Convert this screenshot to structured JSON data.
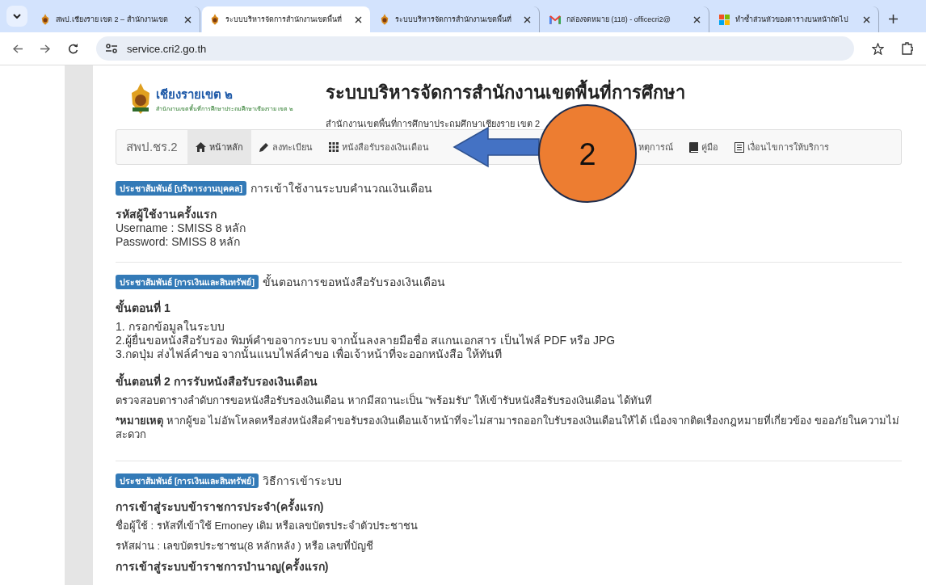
{
  "browser": {
    "tabs": [
      {
        "title": "สพป.เชียงราย เขต 2 – สำนักงานเขต",
        "selected": false
      },
      {
        "title": "ระบบบริหารจัดการสำนักงานเขตพื้นที่",
        "selected": true
      },
      {
        "title": "ระบบบริหารจัดการสำนักงานเขตพื้นที่",
        "selected": false
      },
      {
        "title": "กล่องจดหมาย (118) - officecri2@",
        "selected": false
      },
      {
        "title": "ทำซ้ำส่วนหัวของตารางบนหน้าถัดไป",
        "selected": false
      }
    ],
    "address": "service.cri2.go.th"
  },
  "header": {
    "logo_text": "เชียงรายเขต ๒",
    "logo_subtext": "สำนักงานเขตพื้นที่การศึกษาประถมศึกษาเชียงราย เขต ๒",
    "title": "ระบบบริหารจัดการสำนักงานเขตพื้นที่การศึกษา",
    "subtitle": "สำนักงานเขตพื้นที่การศึกษาประถมศึกษาเชียงราย เขต 2"
  },
  "nav": {
    "brand": "สพป.ชร.2",
    "items": [
      {
        "label": "หน้าหลัก",
        "selected": true
      },
      {
        "label": "ลงทะเบียน",
        "selected": false
      },
      {
        "label": "หนังสือรับรองเงินเดือน",
        "selected": false
      },
      {
        "label": "หตุการณ์",
        "selected": false
      },
      {
        "label": "คู่มือ",
        "selected": false
      },
      {
        "label": "เงื่อนไขการให้บริการ",
        "selected": false
      }
    ]
  },
  "callout": {
    "number": "2"
  },
  "sections": [
    {
      "badge": "ประชาสัมพันธ์ [บริหารงานบุคคล]",
      "title": "การเข้าใช้งานระบบคำนวณเงินเดือน",
      "blocks": [
        {
          "kind": "heading",
          "text": "รหัสผู้ใช้งานครั้งแรก"
        },
        {
          "kind": "large",
          "text": "Username : SMISS 8 หลัก"
        },
        {
          "kind": "large",
          "text": "Password: SMISS 8 หลัก"
        }
      ]
    },
    {
      "badge": "ประชาสัมพันธ์ [การเงินและสินทรัพย์]",
      "title": "ขั้นตอนการขอหนังสือรับรองเงินเดือน",
      "blocks": [
        {
          "kind": "heading",
          "text": "ขั้นตอนที่ 1"
        },
        {
          "kind": "large",
          "text": "1. กรอกข้อมูลในระบบ"
        },
        {
          "kind": "large",
          "text": "2.ผู้ยื่นขอหนังสือรับรอง พิมพ์คำขอจากระบบ จากนั้นลงลายมือชื่อ สแกนเอกสาร เป็นไฟล์ PDF หรือ JPG"
        },
        {
          "kind": "large",
          "text": "3.กดปุ่ม ส่งไฟล์คำขอ จากนั้นแนบไฟล์คำขอ เพื่อเจ้าหน้าที่จะออกหนังสือ ให้ทันที"
        },
        {
          "kind": "heading",
          "text": "ขั้นตอนที่ 2 การรับหนังสือรับรองเงินเดือน"
        },
        {
          "kind": "para",
          "text": "ตรวจสอบตารางลำดับการขอหนังสือรับรองเงินเดือน หากมีสถานะเป็น \"พร้อมรับ\" ให้เข้ารับหนังสือรับรองเงินเดือน  ได้ทันที"
        },
        {
          "kind": "para",
          "text": "***หมายเหตุ**  หากผู้ขอ ไม่อัพโหลดหรือส่งหนังสือคำขอรับรองเงินเดือนเจ้าหน้าที่จะไม่สามารถออกใบรับรองเงินเดือนให้ได้ เนื่องจากติดเรื่องกฎหมายที่เกี่ยวข้อง ขออภัยในความไม่สะดวก"
        }
      ]
    },
    {
      "badge": "ประชาสัมพันธ์ [การเงินและสินทรัพย์]",
      "title": "วิธีการเข้าระบบ",
      "blocks": [
        {
          "kind": "heading",
          "text": "การเข้าสู่ระบบข้าราชการประจำ(ครั้งแรก)"
        },
        {
          "kind": "para",
          "text": "ชื่อผู้ใช้   : รหัสที่เข้าใช้ Emoney เดิม หรือเลขบัตรประจำตัวประชาชน"
        },
        {
          "kind": "para",
          "text": "รหัสผ่าน : เลขบัตรประชาชน(8 หลักหลัง )  หรือ เลขที่บัญชี"
        },
        {
          "kind": "heading",
          "text": "การเข้าสู่ระบบข้าราชการบำนาญ(ครั้งแรก)"
        }
      ]
    }
  ]
}
